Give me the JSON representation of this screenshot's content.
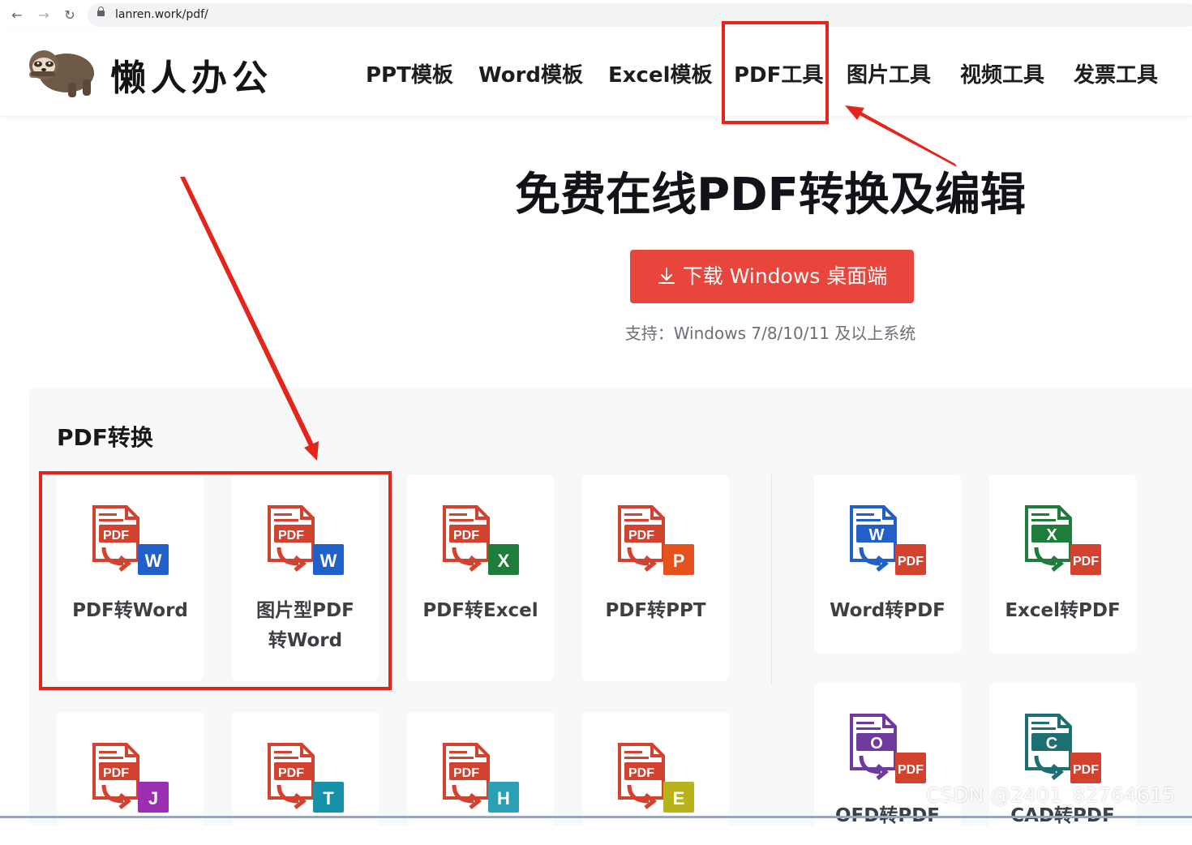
{
  "browser": {
    "url": "lanren.work/pdf/"
  },
  "header": {
    "brand": "懒人办公",
    "menu": [
      "PPT模板",
      "Word模板",
      "Excel模板",
      "PDF工具",
      "图片工具",
      "视频工具",
      "发票工具"
    ]
  },
  "hero": {
    "title": "免费在线PDF转换及编辑",
    "download_label": "下载 Windows 桌面端",
    "support_text": "支持：Windows 7/8/10/11 及以上系统"
  },
  "section": {
    "title": "PDF转换",
    "tools": [
      {
        "label": "PDF转Word",
        "icon": "pdf-to-word-icon",
        "badge": "W",
        "color": "#2260c9"
      },
      {
        "label": "图片型PDF转Word",
        "icon": "image-pdf-to-word-icon",
        "badge": "W",
        "color": "#2260c9"
      },
      {
        "label": "PDF转Excel",
        "icon": "pdf-to-excel-icon",
        "badge": "X",
        "color": "#1e7d3b"
      },
      {
        "label": "PDF转PPT",
        "icon": "pdf-to-ppt-icon",
        "badge": "P",
        "color": "#e4521e"
      },
      {
        "label": "Word转PDF",
        "icon": "word-to-pdf-icon",
        "badge": "W",
        "color": "#2260c9"
      },
      {
        "label": "Excel转PDF",
        "icon": "excel-to-pdf-icon",
        "badge": "X",
        "color": "#1e7d3b"
      },
      {
        "label": "",
        "icon": "pdf-to-jpg-icon",
        "badge": "J",
        "color": "#9b2fb2"
      },
      {
        "label": "",
        "icon": "pdf-to-txt-icon",
        "badge": "T",
        "color": "#1592a8"
      },
      {
        "label": "",
        "icon": "pdf-to-html-icon",
        "badge": "H",
        "color": "#2aa0b3"
      },
      {
        "label": "",
        "icon": "pdf-to-epub-icon",
        "badge": "E",
        "color": "#b8b31b"
      },
      {
        "label": "OFD转PDF",
        "icon": "ofd-to-pdf-icon",
        "badge": "O",
        "color": "#6e3a9e"
      },
      {
        "label": "CAD转PDF",
        "icon": "cad-to-pdf-icon",
        "badge": "C",
        "color": "#1d6f72"
      }
    ]
  },
  "colors": {
    "accent_red": "#e8453c",
    "annotation_red": "#e3251b",
    "pdf_red": "#d3412f"
  },
  "watermark": "CSDN @2401_82764615"
}
